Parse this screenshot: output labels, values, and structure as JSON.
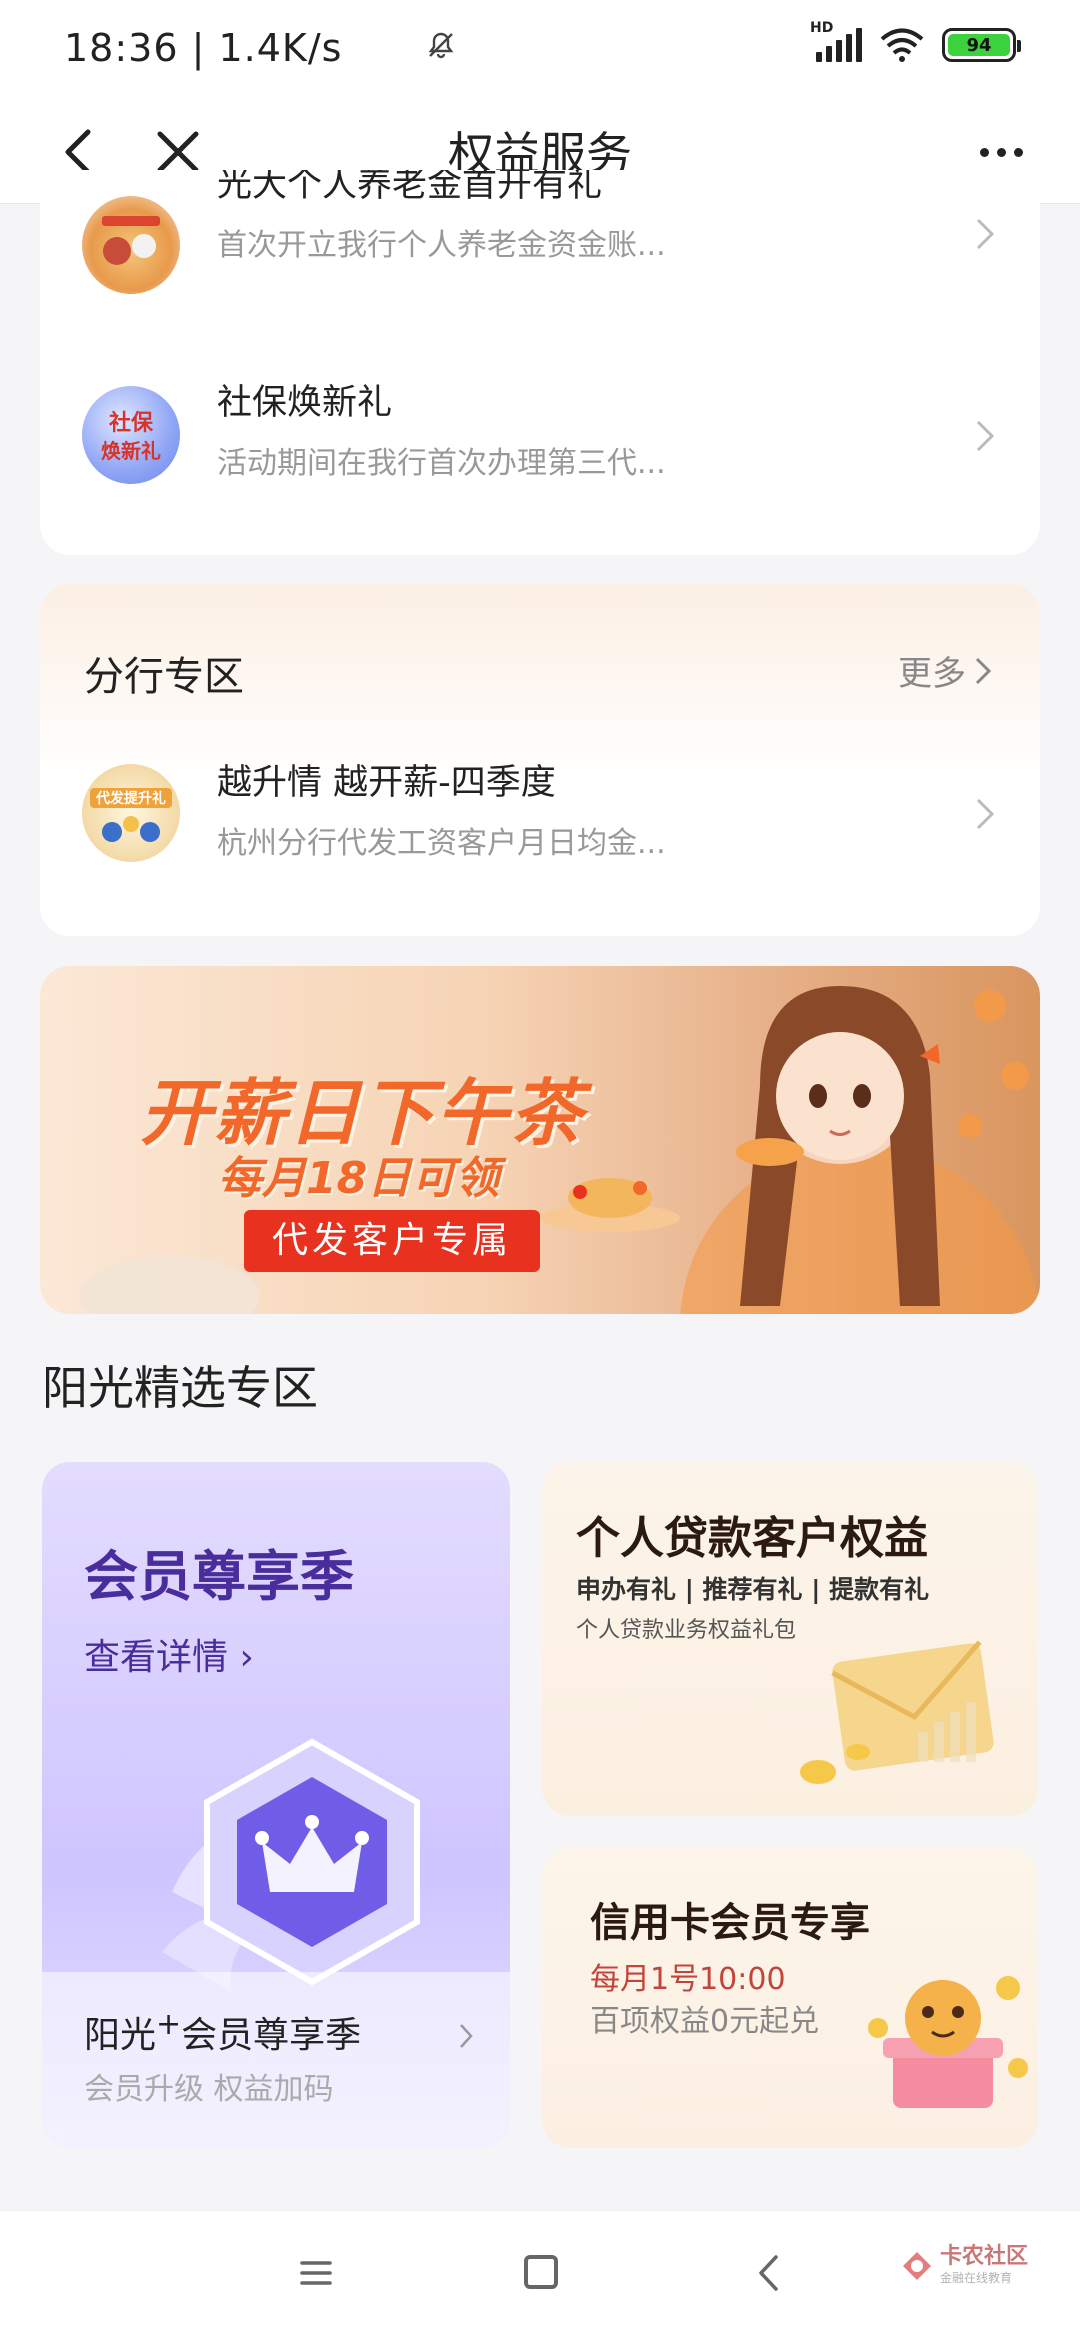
{
  "status_bar": {
    "time": "18:36 | 1.4K/s",
    "signal_label": "HD",
    "battery": "94"
  },
  "nav": {
    "title": "权益服务"
  },
  "card1": {
    "items": [
      {
        "title": "光大个人养老金首开有礼",
        "subtitle": "首次开立我行个人养老金资金账..."
      },
      {
        "title": "社保焕新礼",
        "subtitle": "活动期间在我行首次办理第三代..."
      }
    ]
  },
  "branch": {
    "title": "分行专区",
    "more": "更多",
    "item": {
      "title": "越升情 越开薪-四季度",
      "subtitle": "杭州分行代发工资客户月日均金..."
    }
  },
  "banner": {
    "title": "开薪日下午茶",
    "subtitle": "每月18日可领",
    "tag": "代发客户专属"
  },
  "zone": {
    "title": "阳光精选专区"
  },
  "member_tile": {
    "title": "会员尊享季",
    "link": "查看详情 ›",
    "footer_title": "阳光",
    "footer_sup": "+",
    "footer_title2": "会员尊享季",
    "footer_sub": "会员升级 权益加码"
  },
  "loan_tile": {
    "title": "个人贷款客户权益",
    "tags": "申办有礼 | 推荐有礼 | 提款有礼",
    "desc": "个人贷款业务权益礼包"
  },
  "credit_tile": {
    "title": "信用卡会员专享",
    "time": "每月1号10:00",
    "desc": "百项权益0元起兑"
  },
  "watermark": {
    "name": "卡农社区",
    "tagline": "金融在线教育"
  },
  "colors": {
    "accent_purple": "#4a2d9c",
    "banner_orange": "#f1682a",
    "tag_red": "#e8321f",
    "battery_green": "#3bd23d"
  }
}
